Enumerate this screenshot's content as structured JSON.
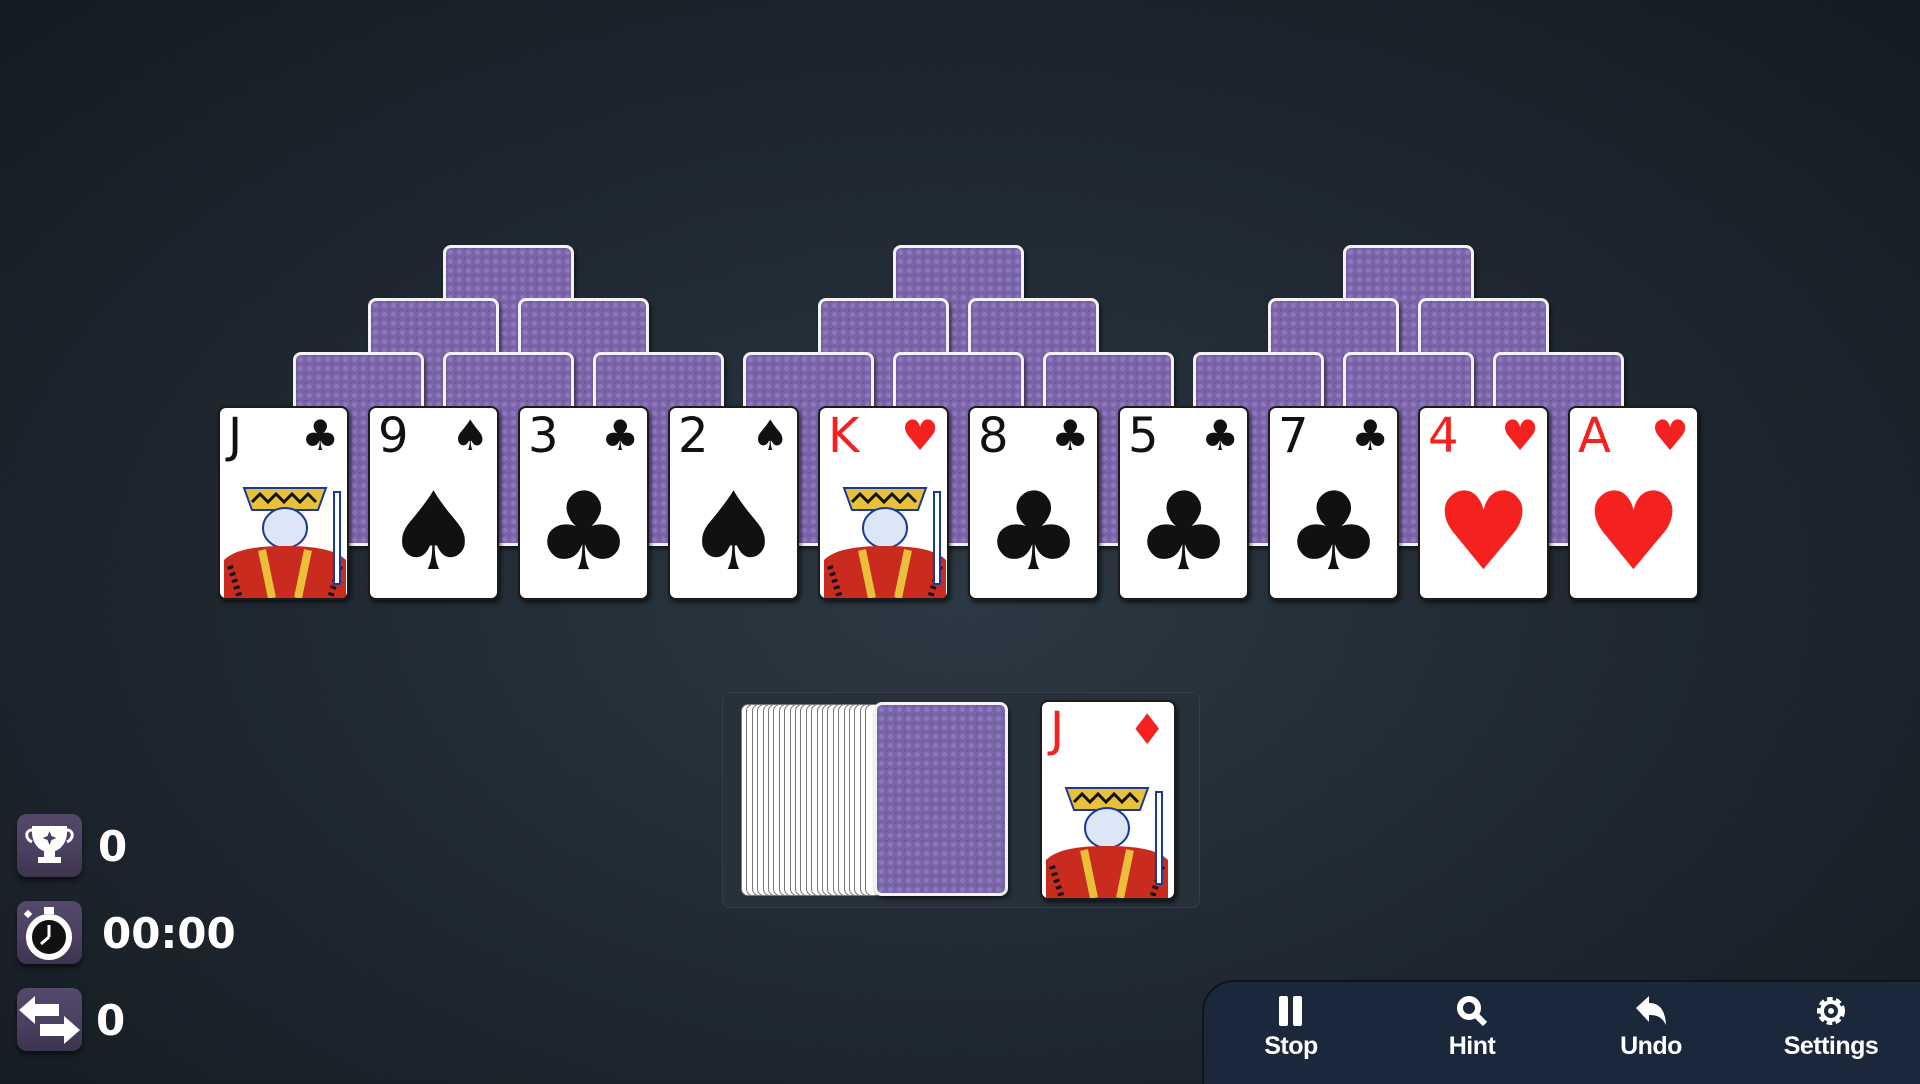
{
  "game": "Tri Peaks Solitaire",
  "peaks": [
    {
      "name": "peak-left",
      "face_down_cards": 6
    },
    {
      "name": "peak-middle",
      "face_down_cards": 6
    },
    {
      "name": "peak-right",
      "face_down_cards": 6
    }
  ],
  "bottom_row": [
    {
      "rank": "J",
      "suit": "clubs",
      "symbol": "♣",
      "color": "black"
    },
    {
      "rank": "9",
      "suit": "spades",
      "symbol": "♠",
      "color": "black"
    },
    {
      "rank": "3",
      "suit": "clubs",
      "symbol": "♣",
      "color": "black"
    },
    {
      "rank": "2",
      "suit": "spades",
      "symbol": "♠",
      "color": "black"
    },
    {
      "rank": "K",
      "suit": "hearts",
      "symbol": "♥",
      "color": "red"
    },
    {
      "rank": "8",
      "suit": "clubs",
      "symbol": "♣",
      "color": "black"
    },
    {
      "rank": "5",
      "suit": "clubs",
      "symbol": "♣",
      "color": "black"
    },
    {
      "rank": "7",
      "suit": "clubs",
      "symbol": "♣",
      "color": "black"
    },
    {
      "rank": "4",
      "suit": "hearts",
      "symbol": "♥",
      "color": "red"
    },
    {
      "rank": "A",
      "suit": "hearts",
      "symbol": "♥",
      "color": "red"
    }
  ],
  "stock": {
    "label": "Stock pile"
  },
  "waste": {
    "rank": "J",
    "suit": "diamonds",
    "symbol": "♦",
    "color": "red"
  },
  "stats": {
    "score_icon": "trophy-icon",
    "score": "0",
    "timer_icon": "stopwatch-icon",
    "time": "00:00",
    "moves_icon": "swap-arrows-icon",
    "moves": "0"
  },
  "toolbar": {
    "stop": {
      "label": "Stop",
      "icon": "pause-icon"
    },
    "hint": {
      "label": "Hint",
      "icon": "magnifier-icon"
    },
    "undo": {
      "label": "Undo",
      "icon": "undo-arrow-icon"
    },
    "settings": {
      "label": "Settings",
      "icon": "gear-icon"
    }
  },
  "colors": {
    "card_back": "#7a63a6",
    "red_suit": "#f4211f",
    "toolbar_bg": "#1b283b",
    "stat_icon_bg": "#4a3f5f"
  }
}
